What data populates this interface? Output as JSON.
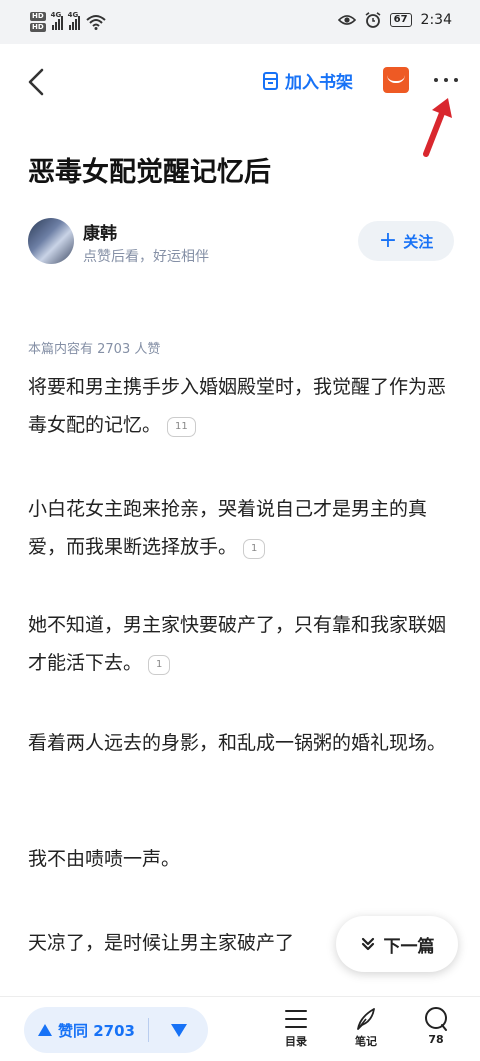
{
  "status_bar": {
    "hd1": "HD",
    "hd2": "HD",
    "net1": "4G",
    "net2": "4G",
    "battery": "67",
    "time": "2:34"
  },
  "topbar": {
    "add_shelf_label": "加入书架"
  },
  "article": {
    "title": "恶毒女配觉醒记忆后",
    "author_name": "康韩",
    "author_signature": "点赞后看，好运相伴",
    "follow_label": "关注",
    "likes_note": "本篇内容有 2703 人赞",
    "paragraphs": [
      {
        "text": "将要和男主携手步入婚姻殿堂时，我觉醒了作为恶毒女配的记忆。",
        "ref": "11"
      },
      {
        "text": "小白花女主跑来抢亲，哭着说自己才是男主的真爱，而我果断选择放手。",
        "ref": "1"
      },
      {
        "text": "她不知道，男主家快要破产了，只有靠和我家联姻才能活下去。",
        "ref": "1"
      },
      {
        "text": "看着两人远去的身影，和乱成一锅粥的婚礼现场。",
        "ref": ""
      },
      {
        "text": "我不由啧啧一声。",
        "ref": ""
      },
      {
        "text": "天凉了，是时候让男主家破产了",
        "ref": ""
      }
    ]
  },
  "next_button_label": "下一篇",
  "bottom_bar": {
    "vote_label": "赞同 2703",
    "toc_label": "目录",
    "notes_label": "笔记",
    "comments_count": "78"
  },
  "colors": {
    "accent": "#1772f6",
    "arrow": "#d9272e",
    "red_box": "#ee5a24"
  }
}
